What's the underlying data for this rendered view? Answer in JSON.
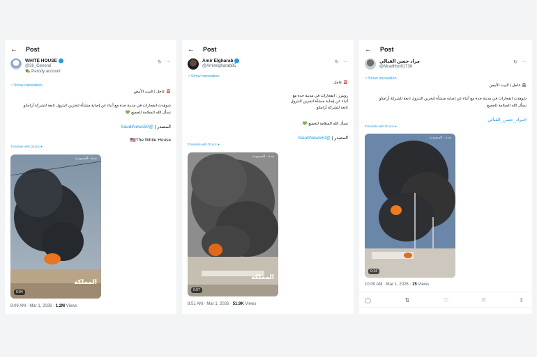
{
  "posts": [
    {
      "header": {
        "title": "Post"
      },
      "account": {
        "display_name": "WHITE HOUSE",
        "handle": "@26_General",
        "label": "Parody account"
      },
      "show_translation": "Show translation",
      "arabic_line1": "🚨 عاجل | البيت الأبيض",
      "arabic_line2": "شوهدت انفجارات في مدينة جدة مع أنباء عن إصابة منشأة لتخزين البترول تابعة للشركة أرامكو",
      "arabic_line3": "نسأل الله السلامة للجميع 💚.",
      "source": "المصدر |",
      "source_link": "@SaudiNews50",
      "signature": "🇺🇸The White House",
      "translate_with": "Translate with Dzoric",
      "video": {
        "duration": "0:04",
        "watermark": "جدة - السعودية",
        "overlay": "المملكة"
      },
      "timestamp": "8:09 AM · Mar 1, 2026 · ",
      "views_count": "1.2M",
      "views_label": " Views"
    },
    {
      "header": {
        "title": "Post"
      },
      "account": {
        "display_name": "Amir Elgharab",
        "handle": "@Amirelgharab85"
      },
      "show_translation": "Show translation",
      "arabic_line1": "🚨 عاجل",
      "arabic_line2": "رويترز : انفجارات في مدينة جدة مع أنباء عن إصابة منشأة لتخزين البترول تابعة للشركة أرامكو .",
      "arabic_line3": "نسأل الله السلامة للجميع 💚.",
      "source": "المصدر |",
      "source_link": "@SaudiNews50",
      "translate_with": "Translate with Dzoric",
      "video": {
        "duration": "0:07",
        "watermark": "جدة - السعودية",
        "overlay": "المملكة"
      },
      "timestamp": "8:51 AM · Mar 1, 2026 · ",
      "views_count": "51.9K",
      "views_label": " Views"
    },
    {
      "header": {
        "title": "Post"
      },
      "account": {
        "display_name": "مراد حسن القبالي",
        "handle": "@MradHsn61738"
      },
      "show_translation": "Show translation",
      "arabic_line1": "🚨 عاجل | البيت الأبيض",
      "arabic_line2": "شوهدت انفجارات في مدينة جدة مع أنباء عن إصابة منشأة لتخزين البترول تابعة للشركة أرامكو",
      "arabic_line3": "نسأل الله السلامة للجميع .",
      "hashtag": "#مراد_حسن_القبالي",
      "translate_with": "Translate with Dzoric",
      "video": {
        "duration": "0:14",
        "watermark": "جدة - السعودية"
      },
      "timestamp": "10:09 AM · Mar 1, 2026 · ",
      "views_count": "15",
      "views_label": " Views"
    }
  ],
  "icons": {
    "back": "←",
    "grok": "↻",
    "more": "···"
  },
  "colors": {
    "link": "#1d9bf0",
    "verified": "#1d9bf0",
    "text": "#0f1419",
    "muted": "#536471"
  }
}
